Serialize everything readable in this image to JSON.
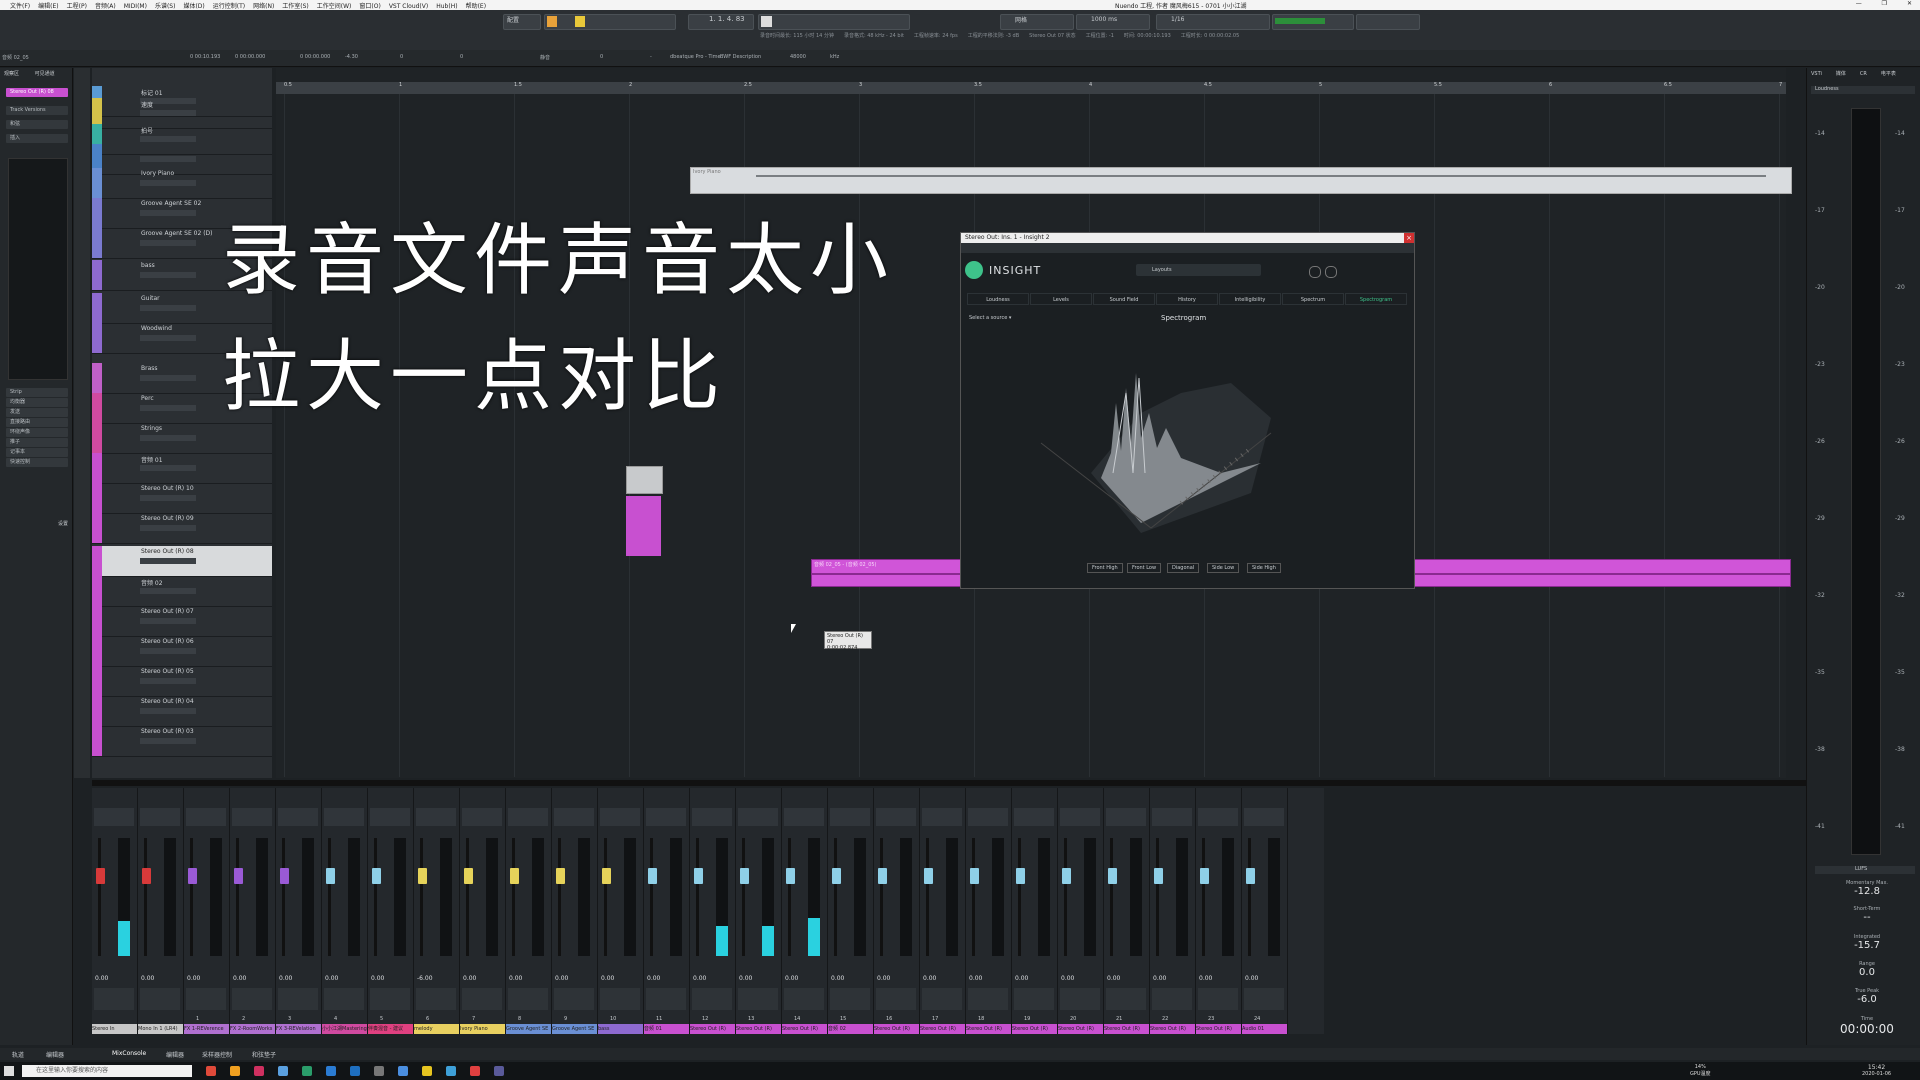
{
  "os_titlebar": {
    "menu_items": [
      "文件(F)",
      "编辑(E)",
      "工程(P)",
      "音频(A)",
      "MIDI(M)",
      "乐谱(S)",
      "媒体(D)",
      "运行控制(T)",
      "网络(N)",
      "工作室(S)",
      "工作空间(W)",
      "窗口(O)",
      "VST Cloud(V)",
      "Hub(H)",
      "帮助(E)"
    ],
    "window_title": "Nuendo 工程, 作者 魔风梅615 - 0701 小小江湖",
    "controls": [
      "—",
      "❐",
      "✕"
    ]
  },
  "toolbar": {
    "position": "1. 1. 4. 83",
    "zoom_label": "1000 ms",
    "quantize": "1/16",
    "grid_label": "网格",
    "layout_label": "配置",
    "info": [
      "录音时间最长: 115 小时 14 分钟",
      "录音格式: 48 kHz - 24 bit",
      "工程帧速率: 24 fps",
      "工程的平移法则: -3 dB",
      "Stereo Out 07 状态",
      "工程位置: -1",
      "时间: 00:00:10.193",
      "工程时长: 0 00:00:02.05"
    ],
    "status_row": [
      "音频 02_05",
      "0 00:10.193",
      "0 00:00.000",
      "0 00:00.000",
      "-4.30",
      "0",
      "0",
      "静音",
      "0",
      "-",
      "dbeatque Pro - Time",
      "BWF Description",
      "48000",
      "kHz"
    ]
  },
  "inspector": {
    "tabs": [
      "观察区",
      "可见通道"
    ],
    "items": [
      "Stereo Out (R) 08",
      "Track Versions",
      "和弦",
      "插入",
      "Strip",
      "均衡器",
      "发送",
      "直接路由",
      "环绕声像",
      "推子",
      "记事本",
      "快速控制"
    ],
    "settings_label": "设置"
  },
  "ruler": {
    "ticks": [
      "0.5",
      "1",
      "1.5",
      "2",
      "2.5",
      "3",
      "3.5",
      "4",
      "4.5",
      "5",
      "5.5",
      "6",
      "6.5",
      "7"
    ]
  },
  "tracks": [
    {
      "name": "标记 01",
      "color": "#5a9bd4"
    },
    {
      "name": "速度",
      "color": "#d4c24a"
    },
    {
      "name": "拍号",
      "color": "#38b0a2"
    },
    {
      "name": "",
      "color": "#4a82c8"
    },
    {
      "name": "Ivory Piano",
      "color": "#6a8fd4"
    },
    {
      "name": "Groove Agent SE 02",
      "color": "#7a7ad0"
    },
    {
      "name": "Groove Agent SE 02 (D)",
      "color": "#7a7ad0"
    },
    {
      "name": "bass",
      "color": "#8e6ad0"
    },
    {
      "name": "Guitar",
      "color": "#8e6ad0"
    },
    {
      "name": "Woodwind",
      "color": "#8e6ad0"
    },
    {
      "name": "Brass",
      "color": "#c060c8"
    },
    {
      "name": "Perc",
      "color": "#d04aa0"
    },
    {
      "name": "Strings",
      "color": "#d04aa0"
    },
    {
      "name": "音频 01",
      "color": "#c850d0"
    },
    {
      "name": "Stereo Out (R) 10",
      "color": "#c850d0"
    },
    {
      "name": "Stereo Out (R) 09",
      "color": "#c850d0"
    },
    {
      "name": "Stereo Out (R) 08",
      "color": "#c850d0"
    },
    {
      "name": "音频 02",
      "color": "#c850d0"
    },
    {
      "name": "Stereo Out (R) 07",
      "color": "#c850d0"
    },
    {
      "name": "Stereo Out (R) 06",
      "color": "#c850d0"
    },
    {
      "name": "Stereo Out (R) 05",
      "color": "#c850d0"
    },
    {
      "name": "Stereo Out (R) 04",
      "color": "#c850d0"
    },
    {
      "name": "Stereo Out (R) 03",
      "color": "#c850d0"
    }
  ],
  "caption": {
    "line1": "录音文件声音太小",
    "line2": "拉大一点对比"
  },
  "tooltip": {
    "line1": "Stereo Out (R) 07",
    "line2": "0:00:02.874"
  },
  "clips": {
    "piano_label": "Ivory Piano",
    "audio_label": "音频 02_05 - (音频 02_05)"
  },
  "plugin": {
    "title": "Stereo Out: Ins. 1 - Insight 2",
    "brand": "INSIGHT",
    "layouts_label": "Layouts",
    "tabs": [
      "Loudness",
      "Levels",
      "Sound Field",
      "History",
      "Intelligibility",
      "Spectrum",
      "Spectrogram"
    ],
    "active_tab": "Spectrogram",
    "source_label": "Select a source",
    "view_title": "Spectrogram",
    "view_buttons": [
      "Front High",
      "Front Low",
      "Diagonal",
      "Side Low",
      "Side High"
    ]
  },
  "mixer": {
    "volumes": [
      "0.00",
      "0.00",
      "0.00",
      "0.00",
      "0.00",
      "0.00",
      "0.00",
      "-6.00",
      "0.00",
      "0.00",
      "0.00",
      "0.00",
      "0.00",
      "0.00",
      "0.00",
      "0.00",
      "0.00",
      "0.00",
      "0.00",
      "0.00",
      "0.00",
      "0.00",
      "0.00",
      "0.00",
      "0.00",
      "0.00"
    ],
    "channel_numbers": [
      "1",
      "2",
      "3",
      "4",
      "5",
      "6",
      "7",
      "8",
      "9",
      "10",
      "11",
      "12",
      "13",
      "14",
      "15",
      "16",
      "17",
      "18",
      "19",
      "20",
      "21",
      "22",
      "23",
      "24"
    ],
    "channels": [
      {
        "name": "Stereo In",
        "color": "#c7c7c7",
        "fader": "#d83a3a",
        "meter": 0.3
      },
      {
        "name": "Mono In 1 (LR4)",
        "color": "#c7c7c7",
        "fader": "#d83a3a",
        "meter": 0.0
      },
      {
        "name": "FX 1-REVerence",
        "color": "#b070d0",
        "fader": "#9a5ad6",
        "meter": 0.0
      },
      {
        "name": "FX 2-RoomWorks",
        "color": "#b070d0",
        "fader": "#9a5ad6",
        "meter": 0.0
      },
      {
        "name": "FX 3-REVelation",
        "color": "#b070d0",
        "fader": "#9a5ad6",
        "meter": 0.0
      },
      {
        "name": "小小江湖Mastering",
        "color": "#d04aa0",
        "fader": "#8fd0e8",
        "meter": 0.0
      },
      {
        "name": "伴奏混音 - 建议",
        "color": "#e04080",
        "fader": "#8fd0e8",
        "meter": 0.0
      },
      {
        "name": "melody",
        "color": "#e8d060",
        "fader": "#e6d35a",
        "meter": 0.0
      },
      {
        "name": "Ivory Piano",
        "color": "#e8d060",
        "fader": "#e6d35a",
        "meter": 0.0
      },
      {
        "name": "Groove Agent SE",
        "color": "#6a8fd4",
        "fader": "#e6d35a",
        "meter": 0.0
      },
      {
        "name": "Groove Agent SE",
        "color": "#6a8fd4",
        "fader": "#e6d35a",
        "meter": 0.0
      },
      {
        "name": "bass",
        "color": "#8e6ad0",
        "fader": "#e6d35a",
        "meter": 0.0
      },
      {
        "name": "音频 01",
        "color": "#c850d0",
        "fader": "#8fd0e8",
        "meter": 0.0
      },
      {
        "name": "Stereo Out (R)",
        "color": "#c850d0",
        "fader": "#8fd0e8",
        "meter": 0.25
      },
      {
        "name": "Stereo Out (R)",
        "color": "#c850d0",
        "fader": "#8fd0e8",
        "meter": 0.25
      },
      {
        "name": "Stereo Out (R)",
        "color": "#c850d0",
        "fader": "#8fd0e8",
        "meter": 0.32
      },
      {
        "name": "音频 02",
        "color": "#c850d0",
        "fader": "#8fd0e8",
        "meter": 0.0
      },
      {
        "name": "Stereo Out (R)",
        "color": "#c850d0",
        "fader": "#8fd0e8",
        "meter": 0.0
      },
      {
        "name": "Stereo Out (R)",
        "color": "#c850d0",
        "fader": "#8fd0e8",
        "meter": 0.0
      },
      {
        "name": "Stereo Out (R)",
        "color": "#c850d0",
        "fader": "#8fd0e8",
        "meter": 0.0
      },
      {
        "name": "Stereo Out (R)",
        "color": "#c850d0",
        "fader": "#8fd0e8",
        "meter": 0.0
      },
      {
        "name": "Stereo Out (R)",
        "color": "#c850d0",
        "fader": "#8fd0e8",
        "meter": 0.0
      },
      {
        "name": "Stereo Out (R)",
        "color": "#c850d0",
        "fader": "#8fd0e8",
        "meter": 0.0
      },
      {
        "name": "Stereo Out (R)",
        "color": "#c850d0",
        "fader": "#8fd0e8",
        "meter": 0.0
      },
      {
        "name": "Stereo Out (R)",
        "color": "#c850d0",
        "fader": "#8fd0e8",
        "meter": 0.0
      },
      {
        "name": "Audio 01",
        "color": "#c850d0",
        "fader": "#8fd0e8",
        "meter": 0.0
      }
    ]
  },
  "loudness_panel": {
    "tabs": [
      "VSTi",
      "媒体",
      "CR",
      "电平表"
    ],
    "header": "Loudness",
    "scale": [
      "-14",
      "-17",
      "-20",
      "-23",
      "-26",
      "-29",
      "-32",
      "-35",
      "-38",
      "-41"
    ],
    "momentary_label": "Momentary Max.",
    "momentary_value": "-12.8",
    "short_term_label": "Short-Term",
    "short_term_value": "--",
    "integrated_label": "Integrated",
    "integrated_value": "-15.7",
    "range_label": "Range",
    "range_value": "0.0",
    "true_peak_label": "True Peak",
    "true_peak_value": "-6.0",
    "time_label": "Time",
    "time_value": "00:00:00",
    "unit": "LUFS",
    "mode": "LUFS"
  },
  "bottom_tabs": [
    "轨道",
    "编辑器",
    "MixConsole",
    "编辑器",
    "采样器控制",
    "和弦垫子"
  ],
  "taskbar": {
    "search_placeholder": "在这里输入你要搜索的内容",
    "cpu": "14%",
    "cpu_label": "GPU温度",
    "time": "15:42",
    "date": "2020-01-06"
  }
}
